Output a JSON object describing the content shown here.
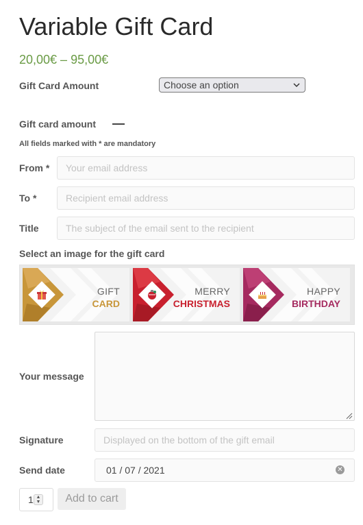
{
  "product": {
    "title": "Variable Gift Card",
    "price_range": "20,00€ – 95,00€"
  },
  "amount_select": {
    "label": "Gift Card Amount",
    "value": "Choose an option"
  },
  "amount_section": {
    "label": "Gift card amount"
  },
  "form": {
    "mandatory_note": "All fields marked with * are mandatory",
    "from": {
      "label": "From *",
      "placeholder": "Your email address"
    },
    "to": {
      "label": "To *",
      "placeholder": "Recipient email address"
    },
    "title": {
      "label": "Title",
      "placeholder": "The subject of the email sent to the recipient"
    },
    "image_select_label": "Select an image for the gift card",
    "designs": [
      {
        "line1": "GIFT",
        "line2": "CARD",
        "color": "#c8963a",
        "icon": "gift-icon"
      },
      {
        "line1": "MERRY",
        "line2": "CHRISTMAS",
        "color": "#c8202e",
        "icon": "ornament-icon"
      },
      {
        "line1": "HAPPY",
        "line2": "BIRTHDAY",
        "color": "#a52a5f",
        "icon": "cake-icon"
      }
    ],
    "message": {
      "label": "Your message",
      "value": ""
    },
    "signature": {
      "label": "Signature",
      "placeholder": "Displayed on the bottom of the gift email"
    },
    "send_date": {
      "label": "Send date",
      "value": "01 / 07 / 2021"
    }
  },
  "cart": {
    "quantity": "1",
    "add_label": "Add to cart"
  }
}
